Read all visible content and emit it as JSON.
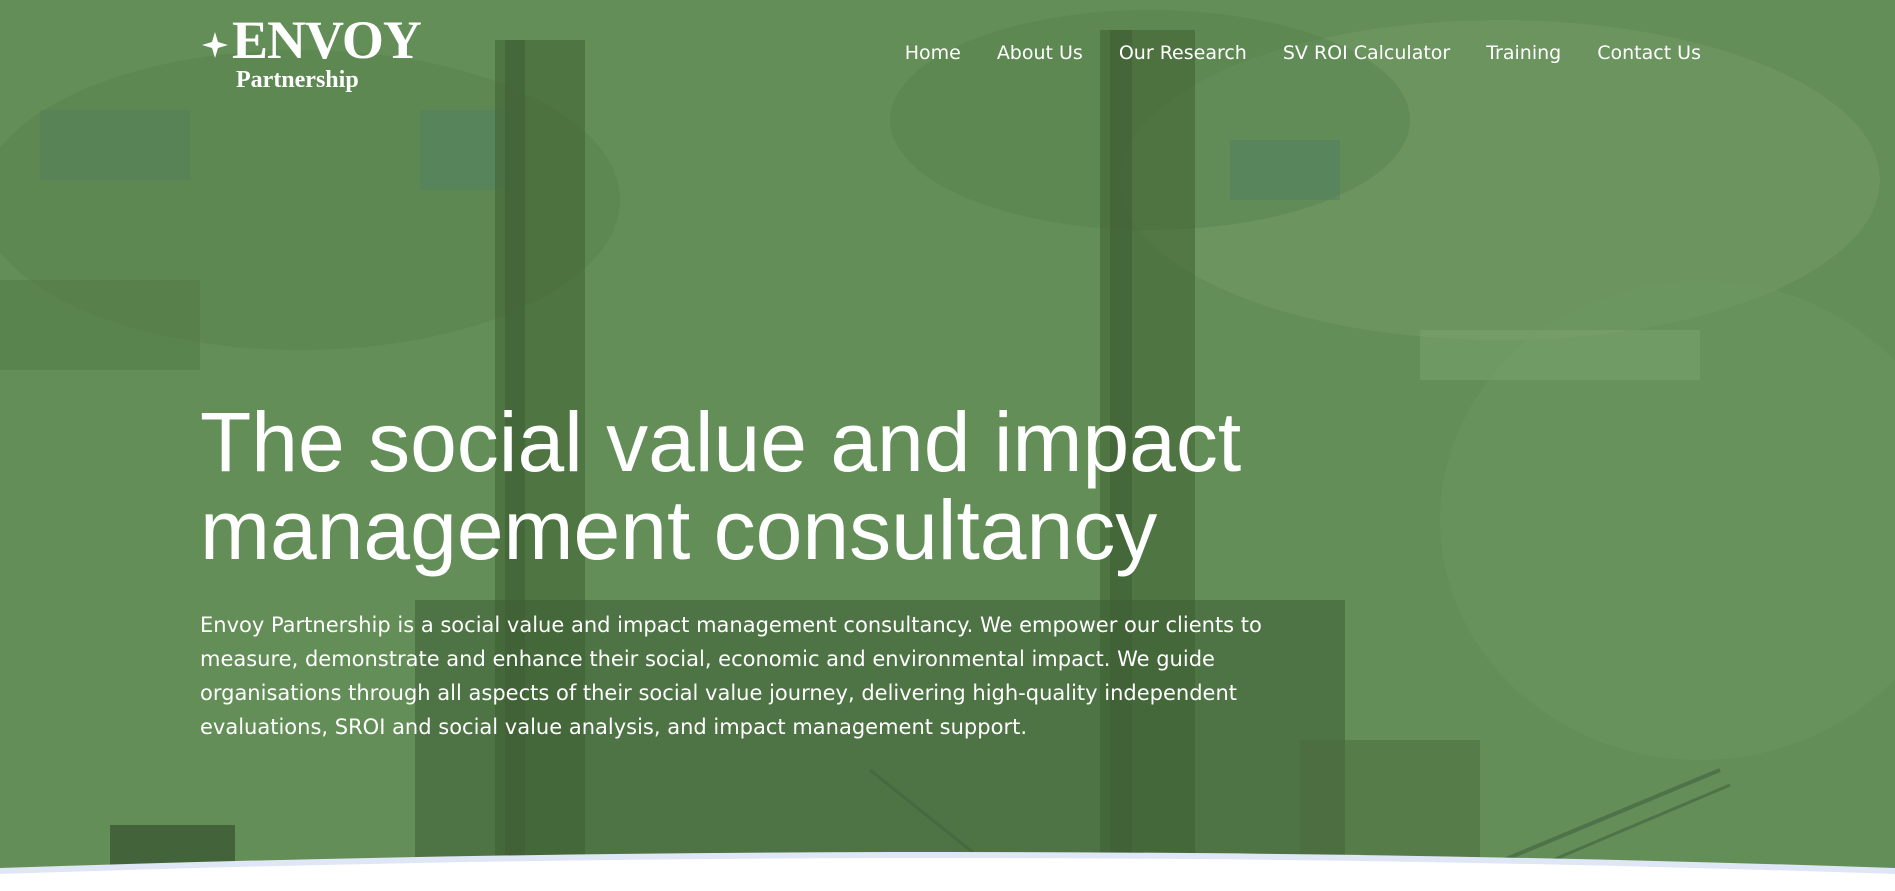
{
  "brand": {
    "logo_main": "ENVOY",
    "logo_sub": "Partnership"
  },
  "nav": {
    "items": [
      {
        "label": "Home"
      },
      {
        "label": "About Us"
      },
      {
        "label": "Our Research"
      },
      {
        "label": "SV ROI Calculator"
      },
      {
        "label": "Training"
      },
      {
        "label": "Contact Us"
      }
    ]
  },
  "hero": {
    "headline": "The social value and impact management consultancy",
    "intro": "Envoy Partnership is a social value and impact management consultancy. We empower our clients to measure, demonstrate and enhance their social, economic and environmental impact. We guide organisations through all aspects of their social value journey, delivering high-quality independent evaluations, SROI and social value analysis, and impact management support."
  },
  "colors": {
    "hero_green": "#5f8a52",
    "chimney_dark": "#3f6132",
    "page_bottom": "#ffffff",
    "curve_edge": "#dfe6f5"
  },
  "icons": {
    "logo_mark": "four-point-star-icon"
  }
}
